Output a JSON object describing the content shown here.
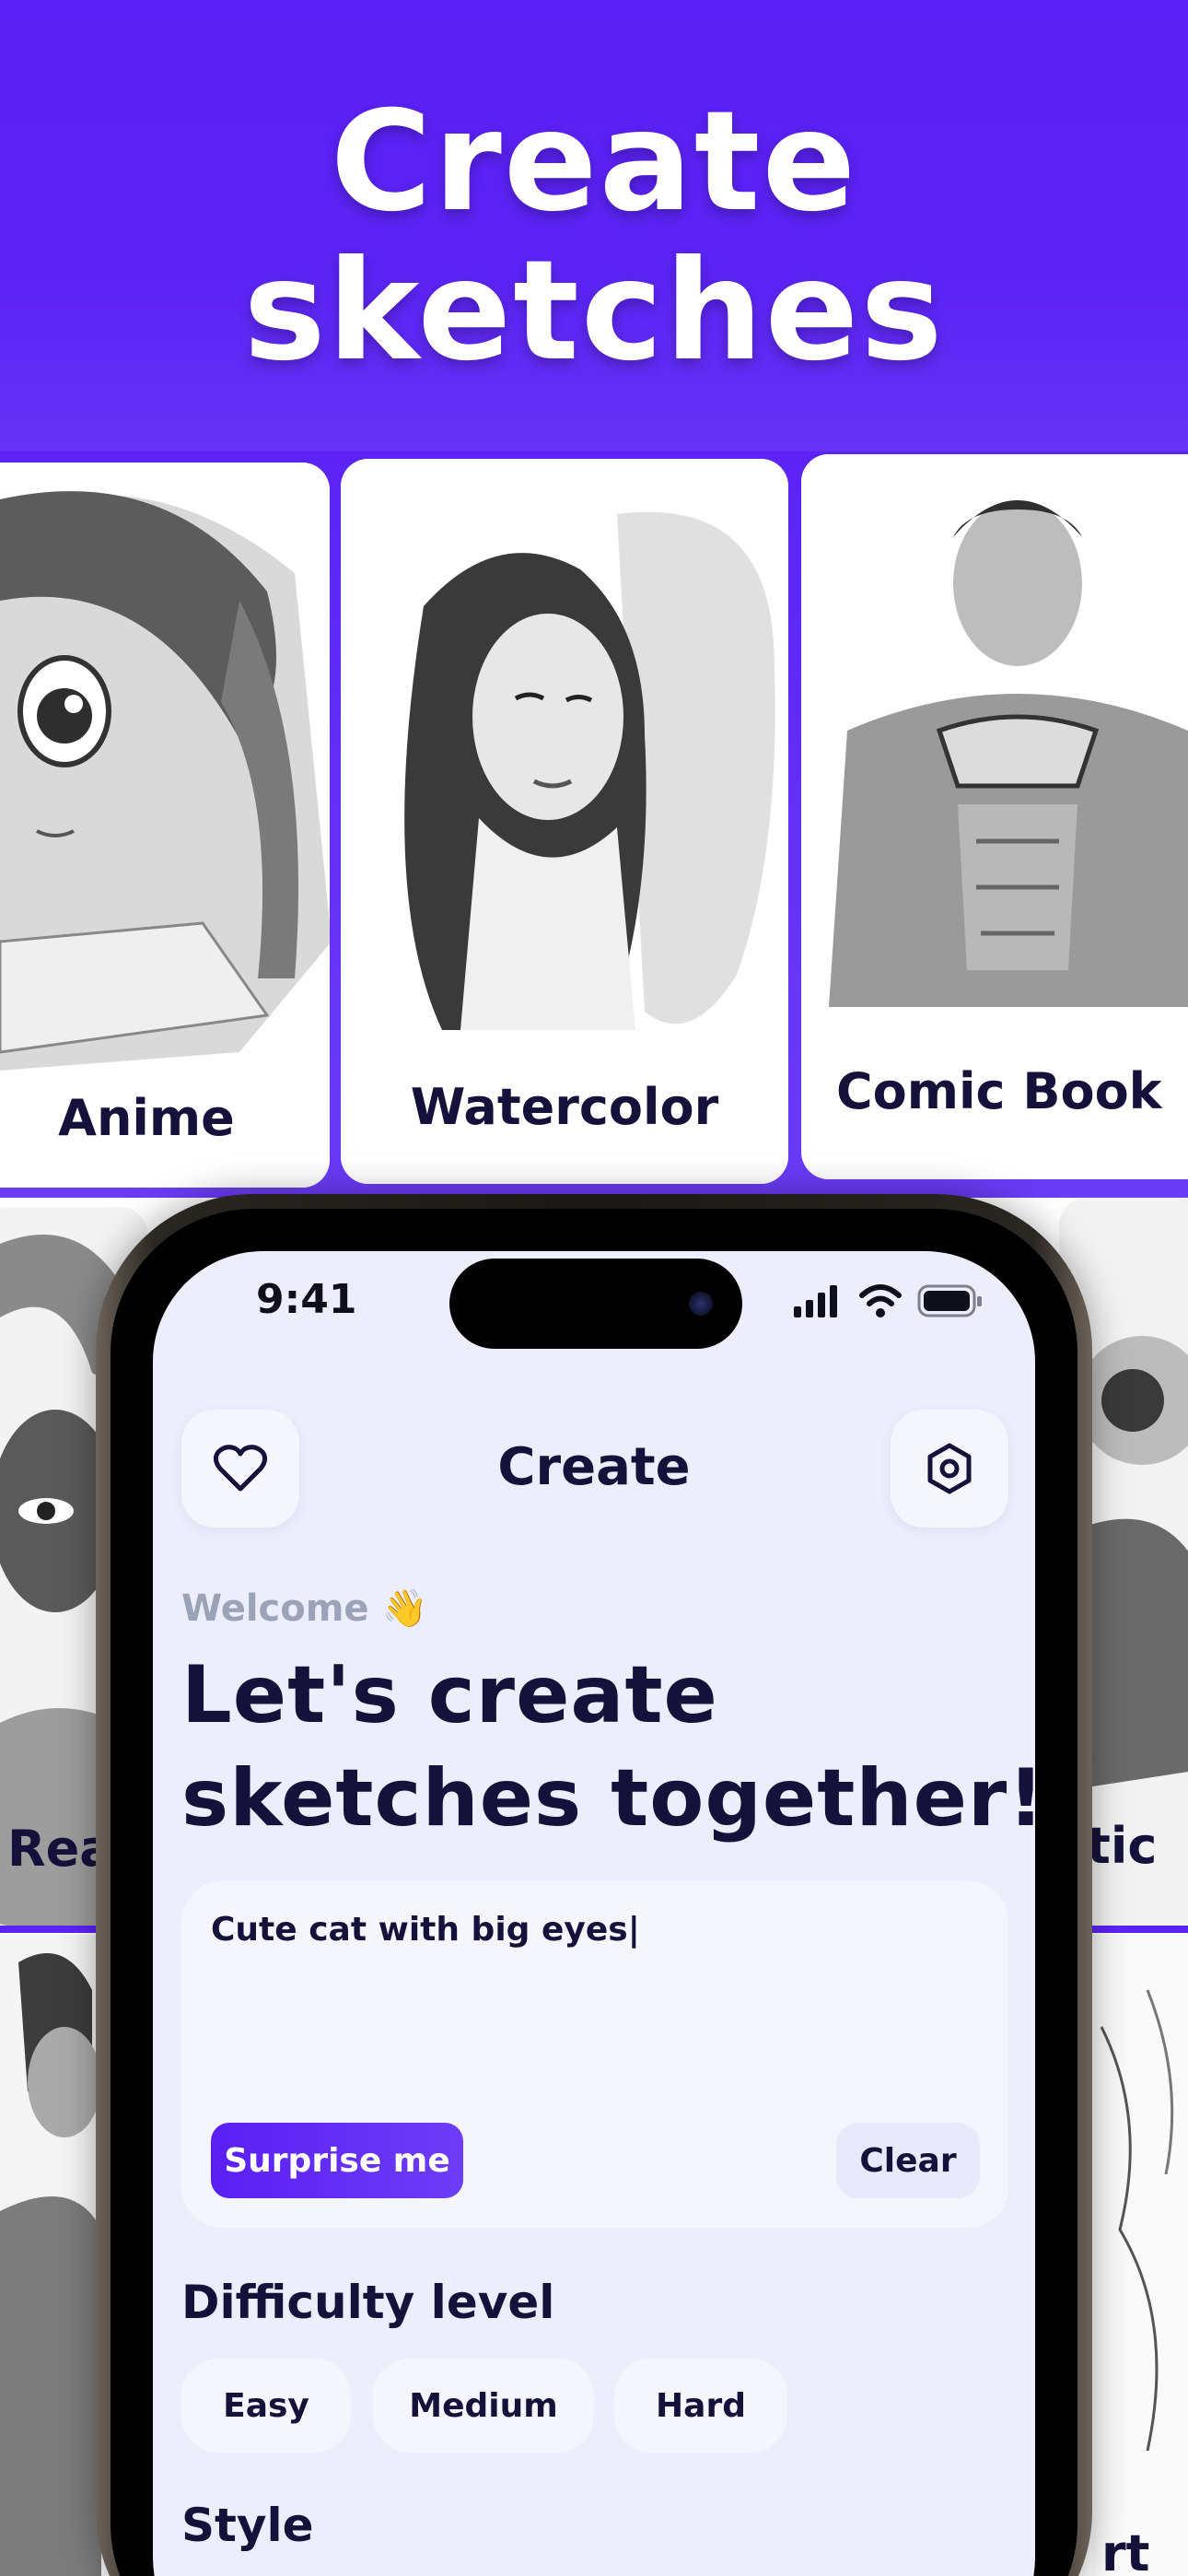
{
  "hero": {
    "line1": "Create",
    "line2": "sketches"
  },
  "style_cards": [
    {
      "label": "Anime"
    },
    {
      "label": "Watercolor"
    },
    {
      "label": "Comic Book"
    },
    {
      "label": "Rea"
    },
    {
      "label": "tic"
    },
    {
      "label": "rt"
    }
  ],
  "status_bar": {
    "time": "9:41"
  },
  "nav": {
    "title": "Create"
  },
  "welcome": {
    "text": "Welcome 👋"
  },
  "headline": {
    "line1": "Let's create",
    "line2": "sketches together!"
  },
  "prompt": {
    "value": "Cute cat with big eyes|",
    "surprise_label": "Surprise me",
    "clear_label": "Clear"
  },
  "difficulty": {
    "title": "Difficulty level",
    "options": [
      "Easy",
      "Medium",
      "Hard"
    ]
  },
  "style": {
    "title": "Style"
  },
  "colors": {
    "brand": "#5B24F5",
    "text_dark": "#14123A",
    "screen_bg": "#ECEEFC"
  }
}
